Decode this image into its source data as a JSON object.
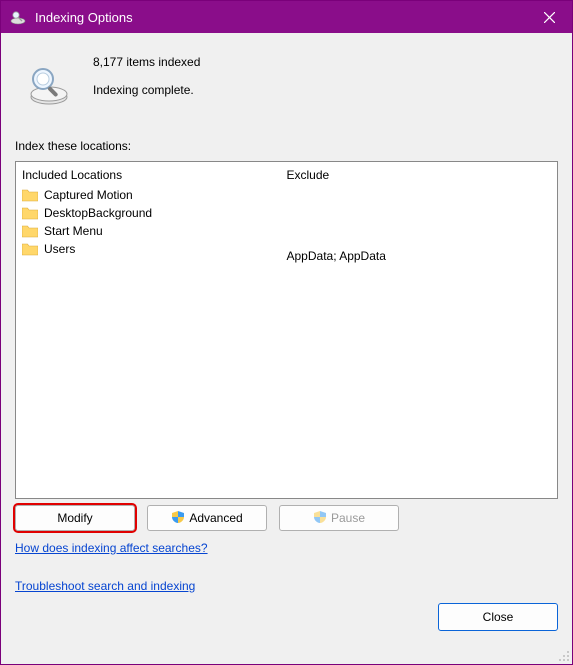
{
  "window": {
    "title": "Indexing Options"
  },
  "status": {
    "count_text": "8,177 items indexed",
    "state_text": "Indexing complete."
  },
  "section_label": "Index these locations:",
  "headers": {
    "included": "Included Locations",
    "exclude": "Exclude"
  },
  "locations": [
    {
      "name": "Captured Motion",
      "exclude": ""
    },
    {
      "name": "DesktopBackground",
      "exclude": ""
    },
    {
      "name": "Start Menu",
      "exclude": ""
    },
    {
      "name": "Users",
      "exclude": "AppData; AppData"
    }
  ],
  "buttons": {
    "modify": "Modify",
    "advanced": "Advanced",
    "pause": "Pause",
    "close": "Close"
  },
  "links": {
    "how": "How does indexing affect searches?",
    "troubleshoot": "Troubleshoot search and indexing"
  }
}
